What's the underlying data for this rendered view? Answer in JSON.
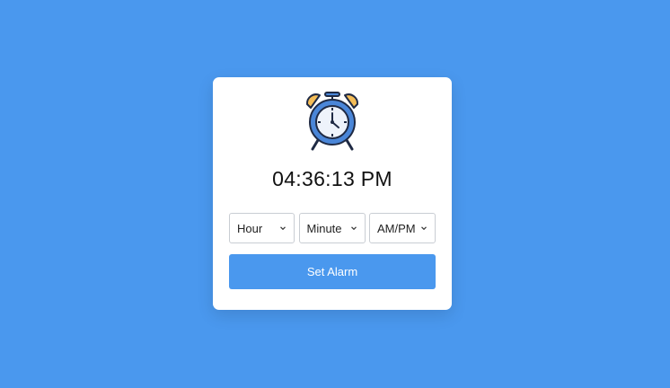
{
  "clock": {
    "icon": "alarm-clock-icon",
    "time": "04:36:13 PM"
  },
  "selects": {
    "hour": "Hour",
    "minute": "Minute",
    "ampm": "AM/PM"
  },
  "button": {
    "label": "Set Alarm"
  },
  "colors": {
    "background": "#4a98ee",
    "card": "#ffffff",
    "button": "#4a98ee",
    "clock_face": "#4a86d8",
    "clock_bell": "#f4bd58"
  }
}
